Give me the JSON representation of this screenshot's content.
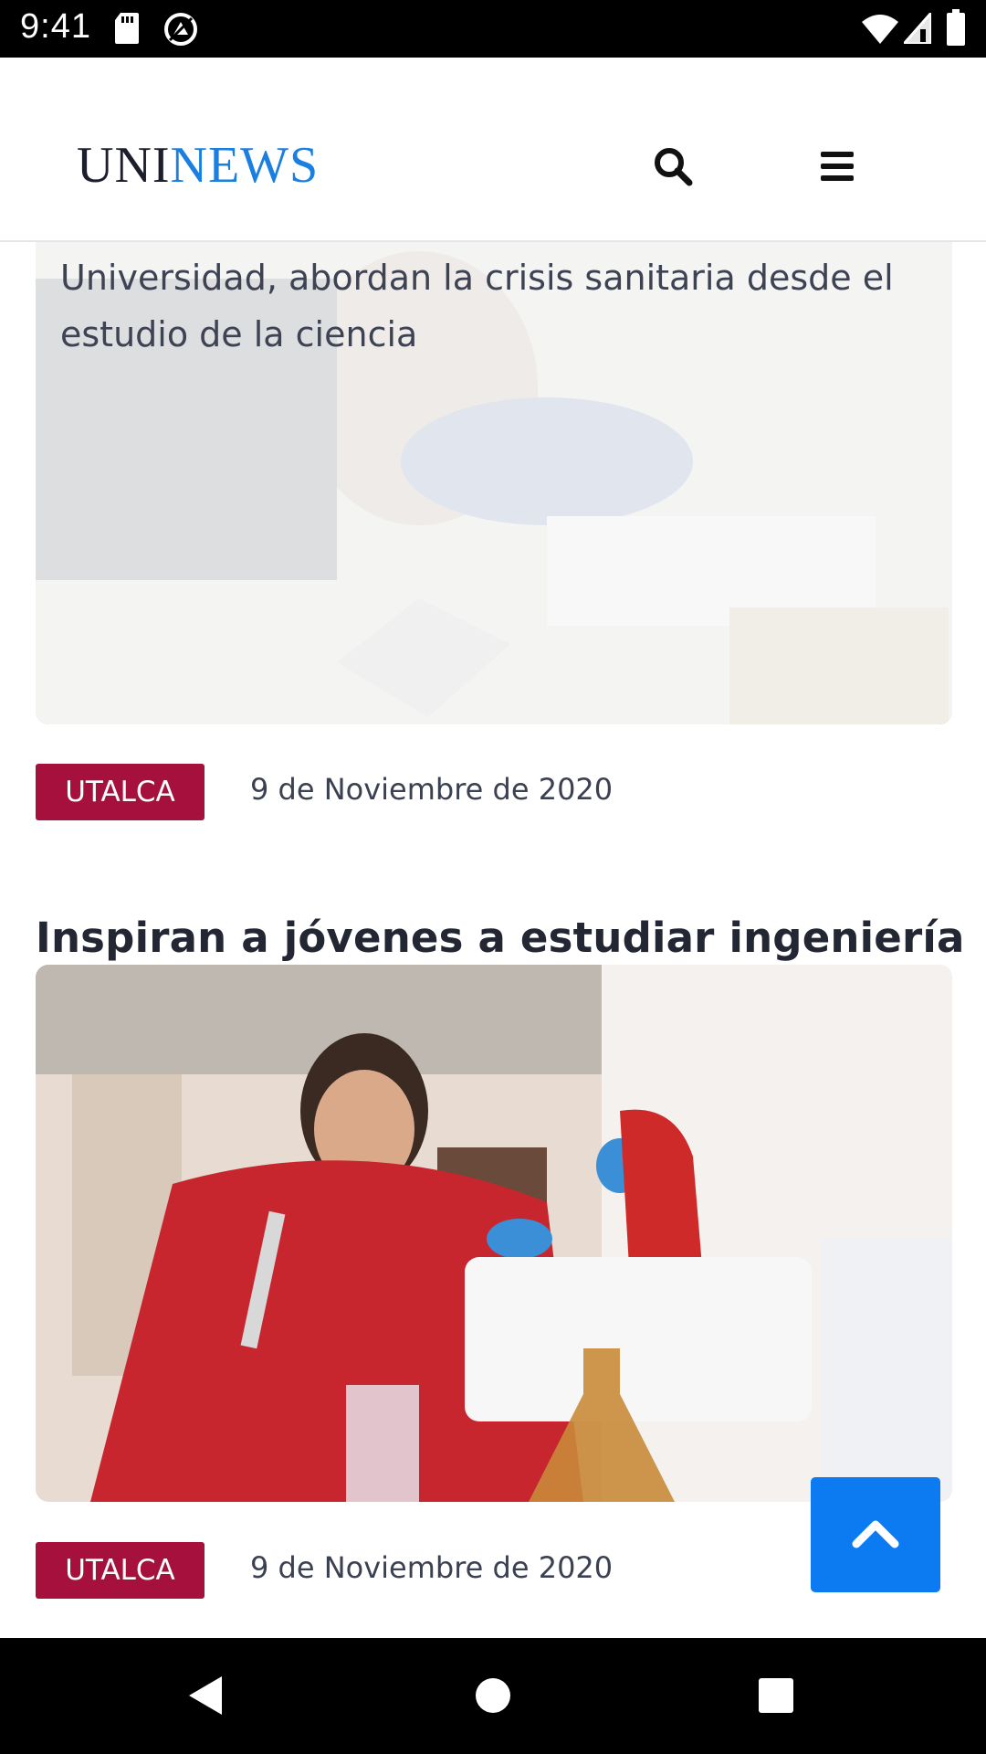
{
  "status_bar": {
    "time": "9:41",
    "icons": [
      "sd-card-icon",
      "vpn-icon",
      "wifi-icon",
      "signal-icon",
      "battery-icon"
    ]
  },
  "header": {
    "logo_part1": "UNI",
    "logo_part2": "NEWS",
    "logo_colors": {
      "uni": "#1c1f2b",
      "news": "#1a7fe0"
    },
    "search_icon": "search-icon",
    "menu_icon": "menu-icon"
  },
  "articles": [
    {
      "title": "Niñas y niños, junto a científicos de la Universidad, abordan la crisis sanitaria desde el estudio de la ciencia",
      "category": "UTALCA",
      "date": "9 de Noviembre de 2020"
    },
    {
      "title": "Inspiran a jóvenes a estudiar ingeniería",
      "category": "UTALCA",
      "date": "9 de Noviembre de 2020"
    }
  ],
  "colors": {
    "badge": "#a5113c",
    "accent": "#0c7bf2"
  },
  "back_to_top_icon": "chevron-up-icon",
  "nav_bar": {
    "icons": [
      "back-icon",
      "home-icon",
      "recents-icon"
    ]
  }
}
